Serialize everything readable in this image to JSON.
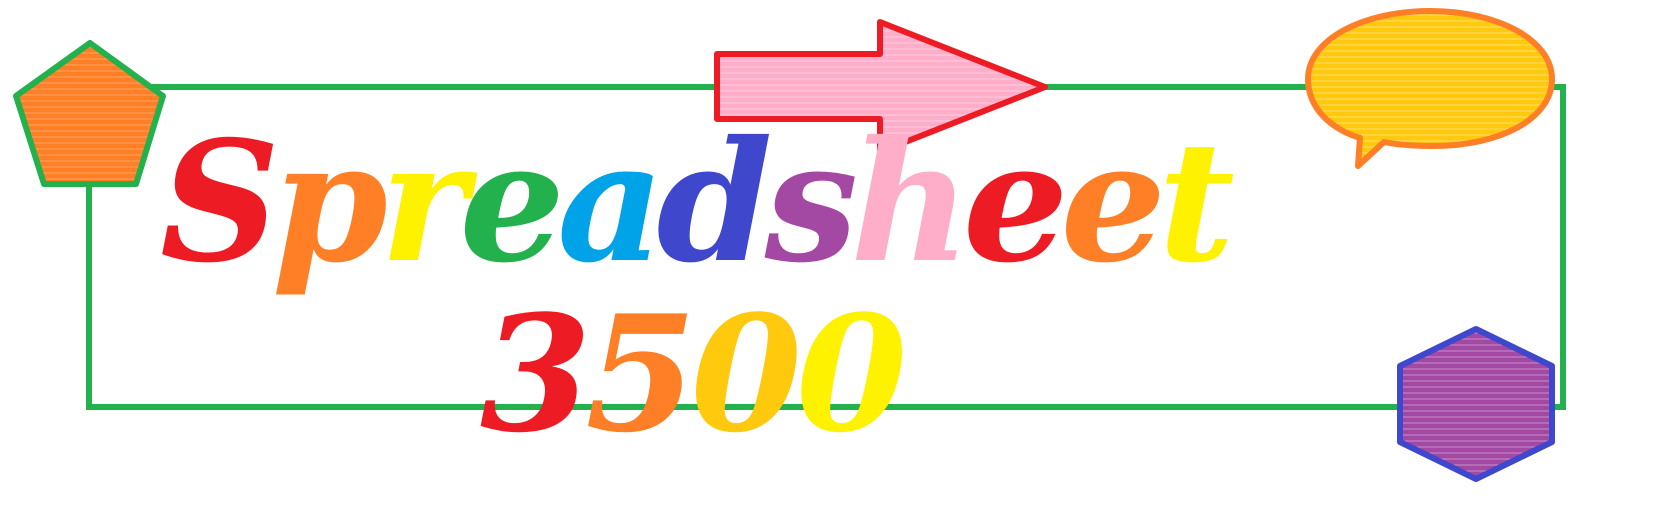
{
  "logo": {
    "word_letters": [
      "S",
      "p",
      "r",
      "e",
      "a",
      "d",
      "s",
      "h",
      "e",
      "e",
      "t"
    ],
    "word_colors": [
      "#ed1c24",
      "#ff7f27",
      "#fff200",
      "#22b14c",
      "#00a2e8",
      "#3f48cc",
      "#a349a4",
      "#ffaec9",
      "#ed1c24",
      "#ff7f27",
      "#fff200"
    ],
    "number_digits": [
      "3",
      "5",
      "0",
      "0"
    ],
    "number_colors": [
      "#ed1c24",
      "#ff7f27",
      "#ffc90e",
      "#fff200"
    ]
  },
  "decorations": {
    "frame_color": "#22b14c",
    "pentagon": {
      "fill": "#ff7f27",
      "stroke": "#22b14c",
      "icon": "pentagon-icon"
    },
    "arrow": {
      "fill": "#ffaec9",
      "stroke": "#ed1c24",
      "icon": "right-arrow-icon"
    },
    "speech_bubble": {
      "fill": "#ffc90e",
      "stroke": "#ff7f27",
      "icon": "speech-bubble-icon"
    },
    "hexagon": {
      "fill": "#a349a4",
      "stroke": "#3f48cc",
      "icon": "hexagon-icon"
    }
  }
}
